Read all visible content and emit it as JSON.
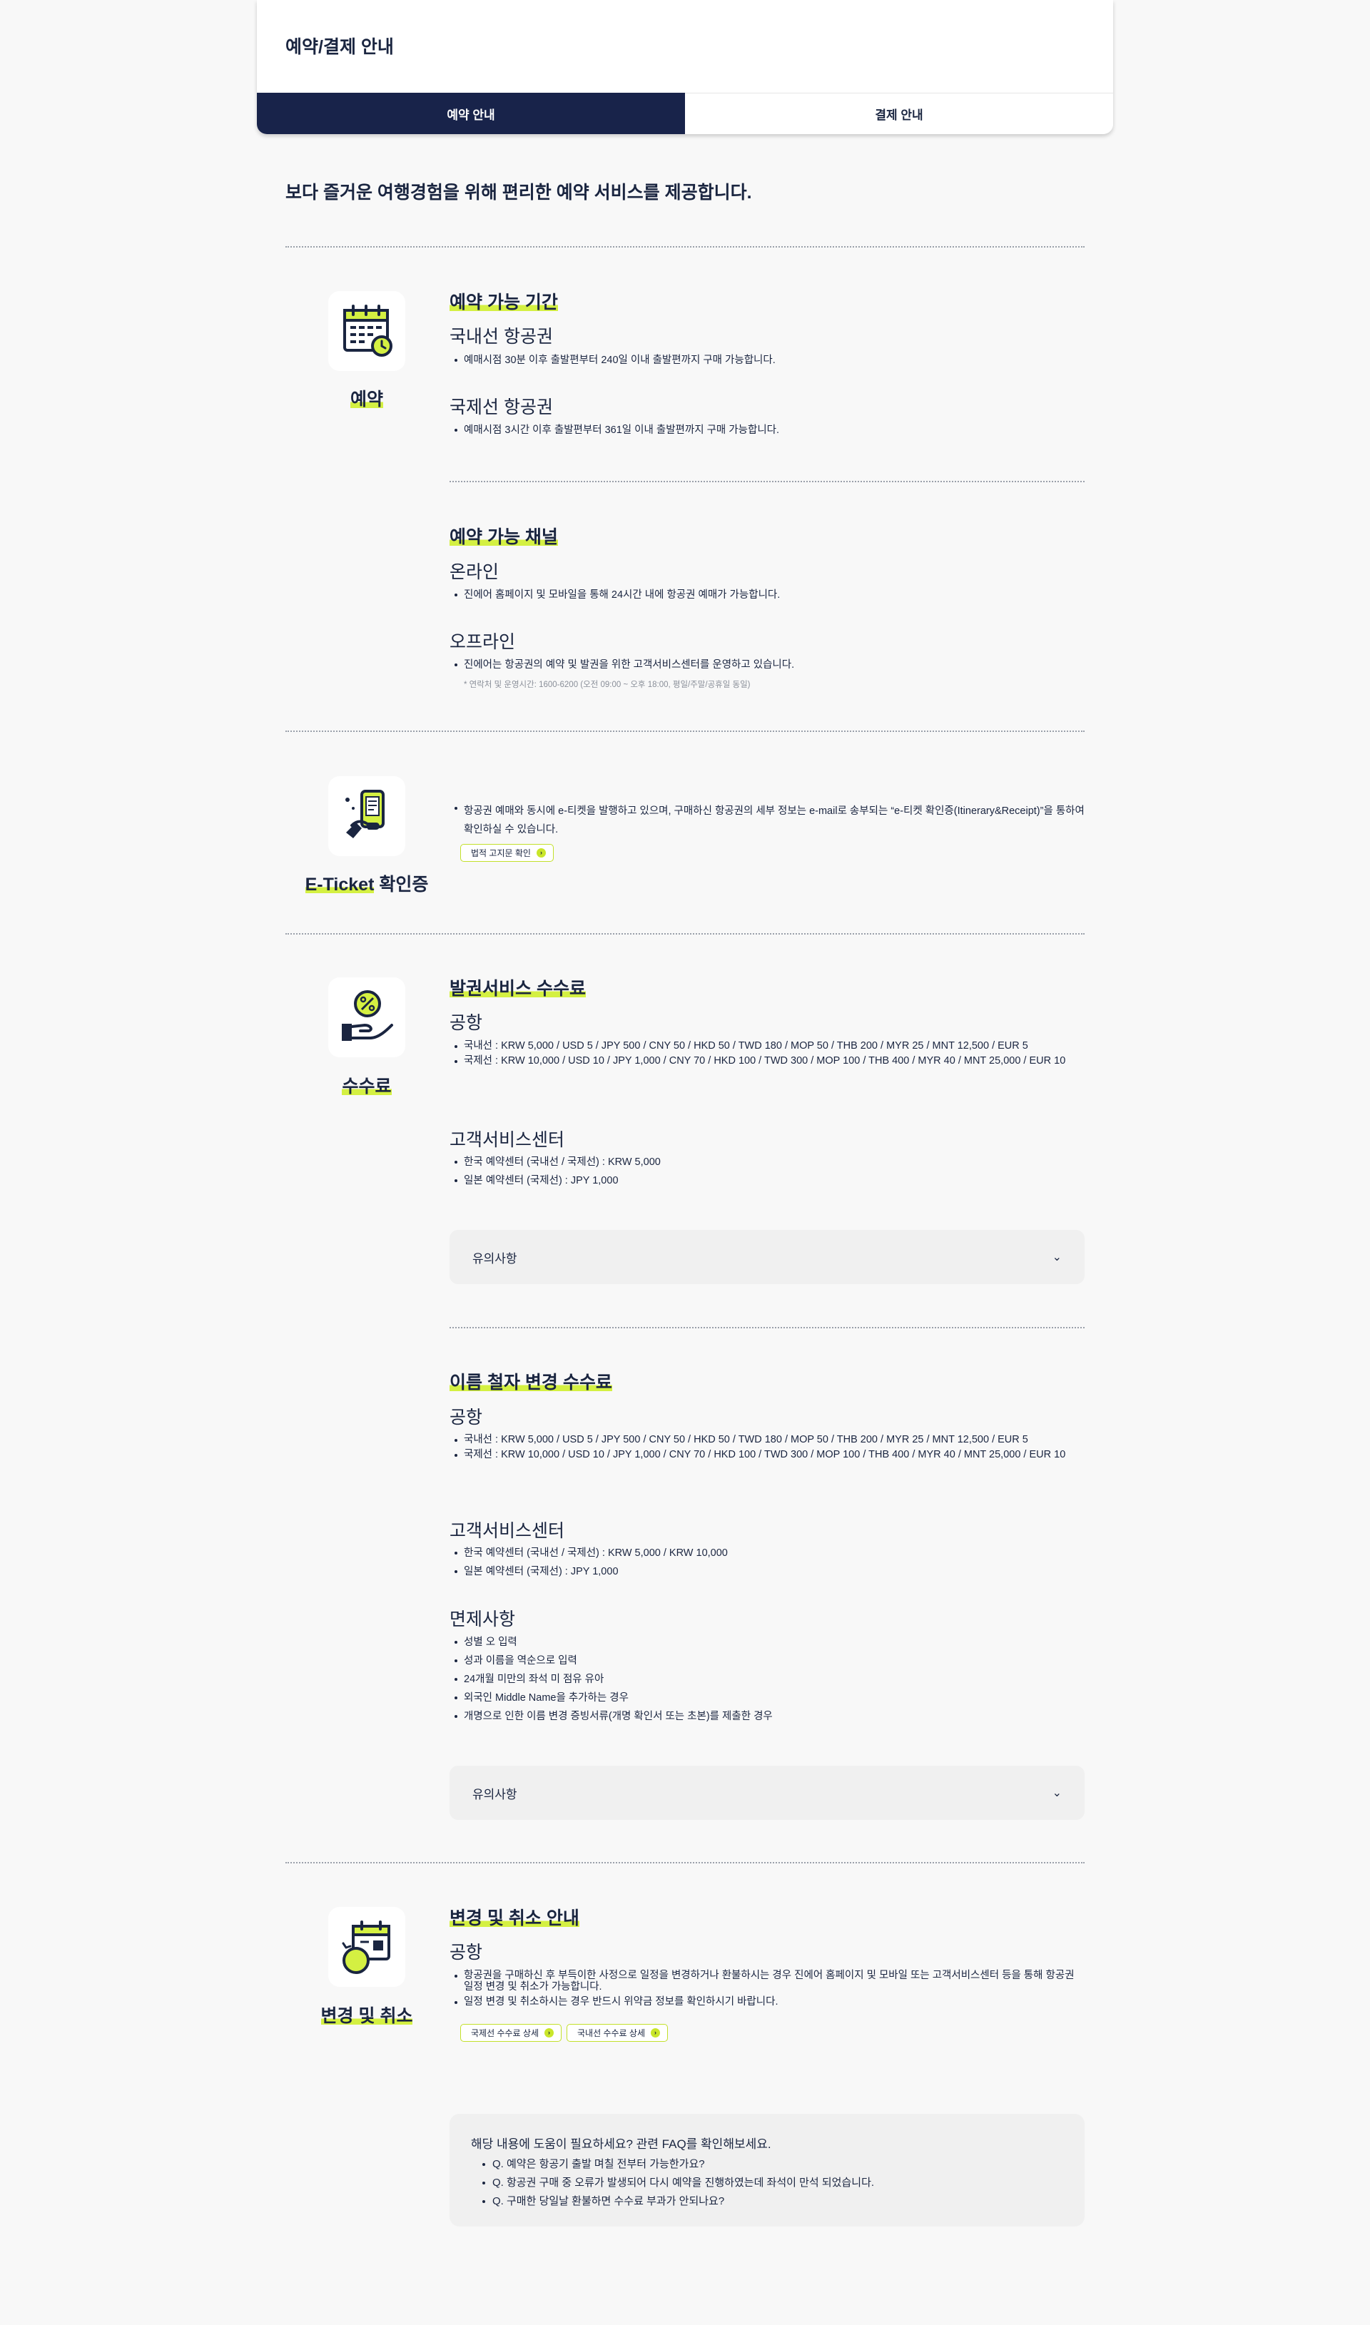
{
  "header": {
    "title": "예약/결제 안내",
    "tabs": [
      {
        "label": "예약 안내",
        "active": true
      },
      {
        "label": "결제 안내",
        "active": false
      }
    ]
  },
  "intro": "보다 즐거운 여행경험을 위해 편리한 예약 서비스를 제공합니다.",
  "colors": {
    "navy": "#18234a",
    "accent": "#c9e62a",
    "background": "#f8f8f8"
  },
  "reservation": {
    "side_label": "예약",
    "icon": "calendar-icon",
    "period": {
      "title": "예약 가능 기간",
      "domestic": {
        "title": "국내선 항공권",
        "items": [
          "예매시점 30분 이후 출발편부터 240일 이내 출발편까지 구매 가능합니다."
        ]
      },
      "international": {
        "title": "국제선 항공권",
        "items": [
          "예매시점 3시간 이후 출발편부터 361일 이내 출발편까지 구매 가능합니다."
        ]
      }
    },
    "channels": {
      "title": "예약 가능 채널",
      "online": {
        "title": "온라인",
        "items": [
          "진에어 홈페이지 및 모바일을 통해 24시간 내에 항공권 예매가 가능합니다."
        ]
      },
      "offline": {
        "title": "오프라인",
        "items": [
          "진에어는 항공권의 예약 및 발권을 위한 고객서비스센터를 운영하고 있습니다."
        ],
        "note": "* 연락처 및 운영시간: 1600-6200 (오전 09:00 ~ 오후 18:00, 평일/주말/공휴일 동일)"
      }
    }
  },
  "eticket": {
    "side_label_a": "E-Ticket",
    "side_label_b": " 확인증",
    "icon": "phone-ticket-icon",
    "items": [
      "항공권 예매와 동시에 e-티켓을 발행하고 있으며, 구매하신 항공권의 세부 정보는 e-mail로 송부되는 “e-티켓 확인증(Itinerary&Receipt)”을 통하여 확인하실 수 있습니다."
    ],
    "button": "법적 고지문 확인"
  },
  "fees": {
    "side_label": "수수료",
    "icon": "percent-hand-icon",
    "issuance": {
      "title": "발권서비스 수수료",
      "airport": {
        "title": "공항",
        "items": [
          "국내선 : KRW 5,000 / USD 5 / JPY 500 / CNY 50 / HKD 50 / TWD 180 / MOP 50 / THB 200 / MYR 25 / MNT 12,500 / EUR 5",
          "국제선 : KRW 10,000 / USD 10 / JPY 1,000 / CNY 70 / HKD 100 / TWD 300 / MOP 100 / THB 400 / MYR 40 / MNT 25,000 / EUR 10"
        ]
      },
      "center": {
        "title": "고객서비스센터",
        "items": [
          "한국 예약센터 (국내선 / 국제선) : KRW 5,000",
          "일본 예약센터 (국제선) : JPY 1,000"
        ]
      },
      "accordion": "유의사항"
    },
    "name_change": {
      "title": "이름 철자 변경 수수료",
      "airport": {
        "title": "공항",
        "items": [
          "국내선 : KRW 5,000 / USD 5 / JPY 500 / CNY 50 / HKD 50 / TWD 180 / MOP 50 / THB 200 / MYR 25 / MNT 12,500 / EUR 5",
          "국제선 : KRW 10,000 / USD 10 / JPY 1,000 / CNY 70 / HKD 100 / TWD 300 / MOP 100 / THB 400 / MYR 40 / MNT 25,000 / EUR 10"
        ]
      },
      "center": {
        "title": "고객서비스센터",
        "items": [
          "한국 예약센터 (국내선 / 국제선) : KRW 5,000 / KRW 10,000",
          "일본 예약센터 (국제선) : JPY 1,000"
        ]
      },
      "exemption": {
        "title": "면제사항",
        "items": [
          "성별 오 입력",
          "성과 이름을 역순으로 입력",
          "24개월 미만의 좌석 미 점유 유아",
          "외국인 Middle Name을 추가하는 경우",
          "개명으로 인한 이름 변경 증빙서류(개명 확인서 또는 초본)를 제출한 경우"
        ]
      },
      "accordion": "유의사항"
    }
  },
  "change": {
    "side_label": "변경 및 취소",
    "icon": "calendar-clock-icon",
    "title": "변경 및 취소 안내",
    "airport": {
      "title": "공항",
      "items": [
        "항공권을 구매하신 후 부득이한 사정으로 일정을 변경하거나 환불하시는 경우 진에어 홈페이지 및 모바일 또는 고객서비스센터 등을 통해 항공권 일정 변경 및 취소가 가능합니다.",
        "일정 변경 및 취소하시는 경우 반드시 위약금 정보를 확인하시기 바랍니다."
      ]
    },
    "buttons": [
      "국제선 수수료 상세",
      "국내선 수수료 상세"
    ]
  },
  "faq": {
    "title": "해당 내용에 도움이 필요하세요? 관련 FAQ를 확인해보세요.",
    "items": [
      "Q. 예약은 항공기 출발 며칠 전부터 가능한가요?",
      "Q. 항공권 구매 중 오류가 발생되어 다시 예약을 진행하였는데 좌석이 만석 되었습니다.",
      "Q. 구매한 당일날 환불하면 수수료 부과가 안되나요?"
    ]
  }
}
